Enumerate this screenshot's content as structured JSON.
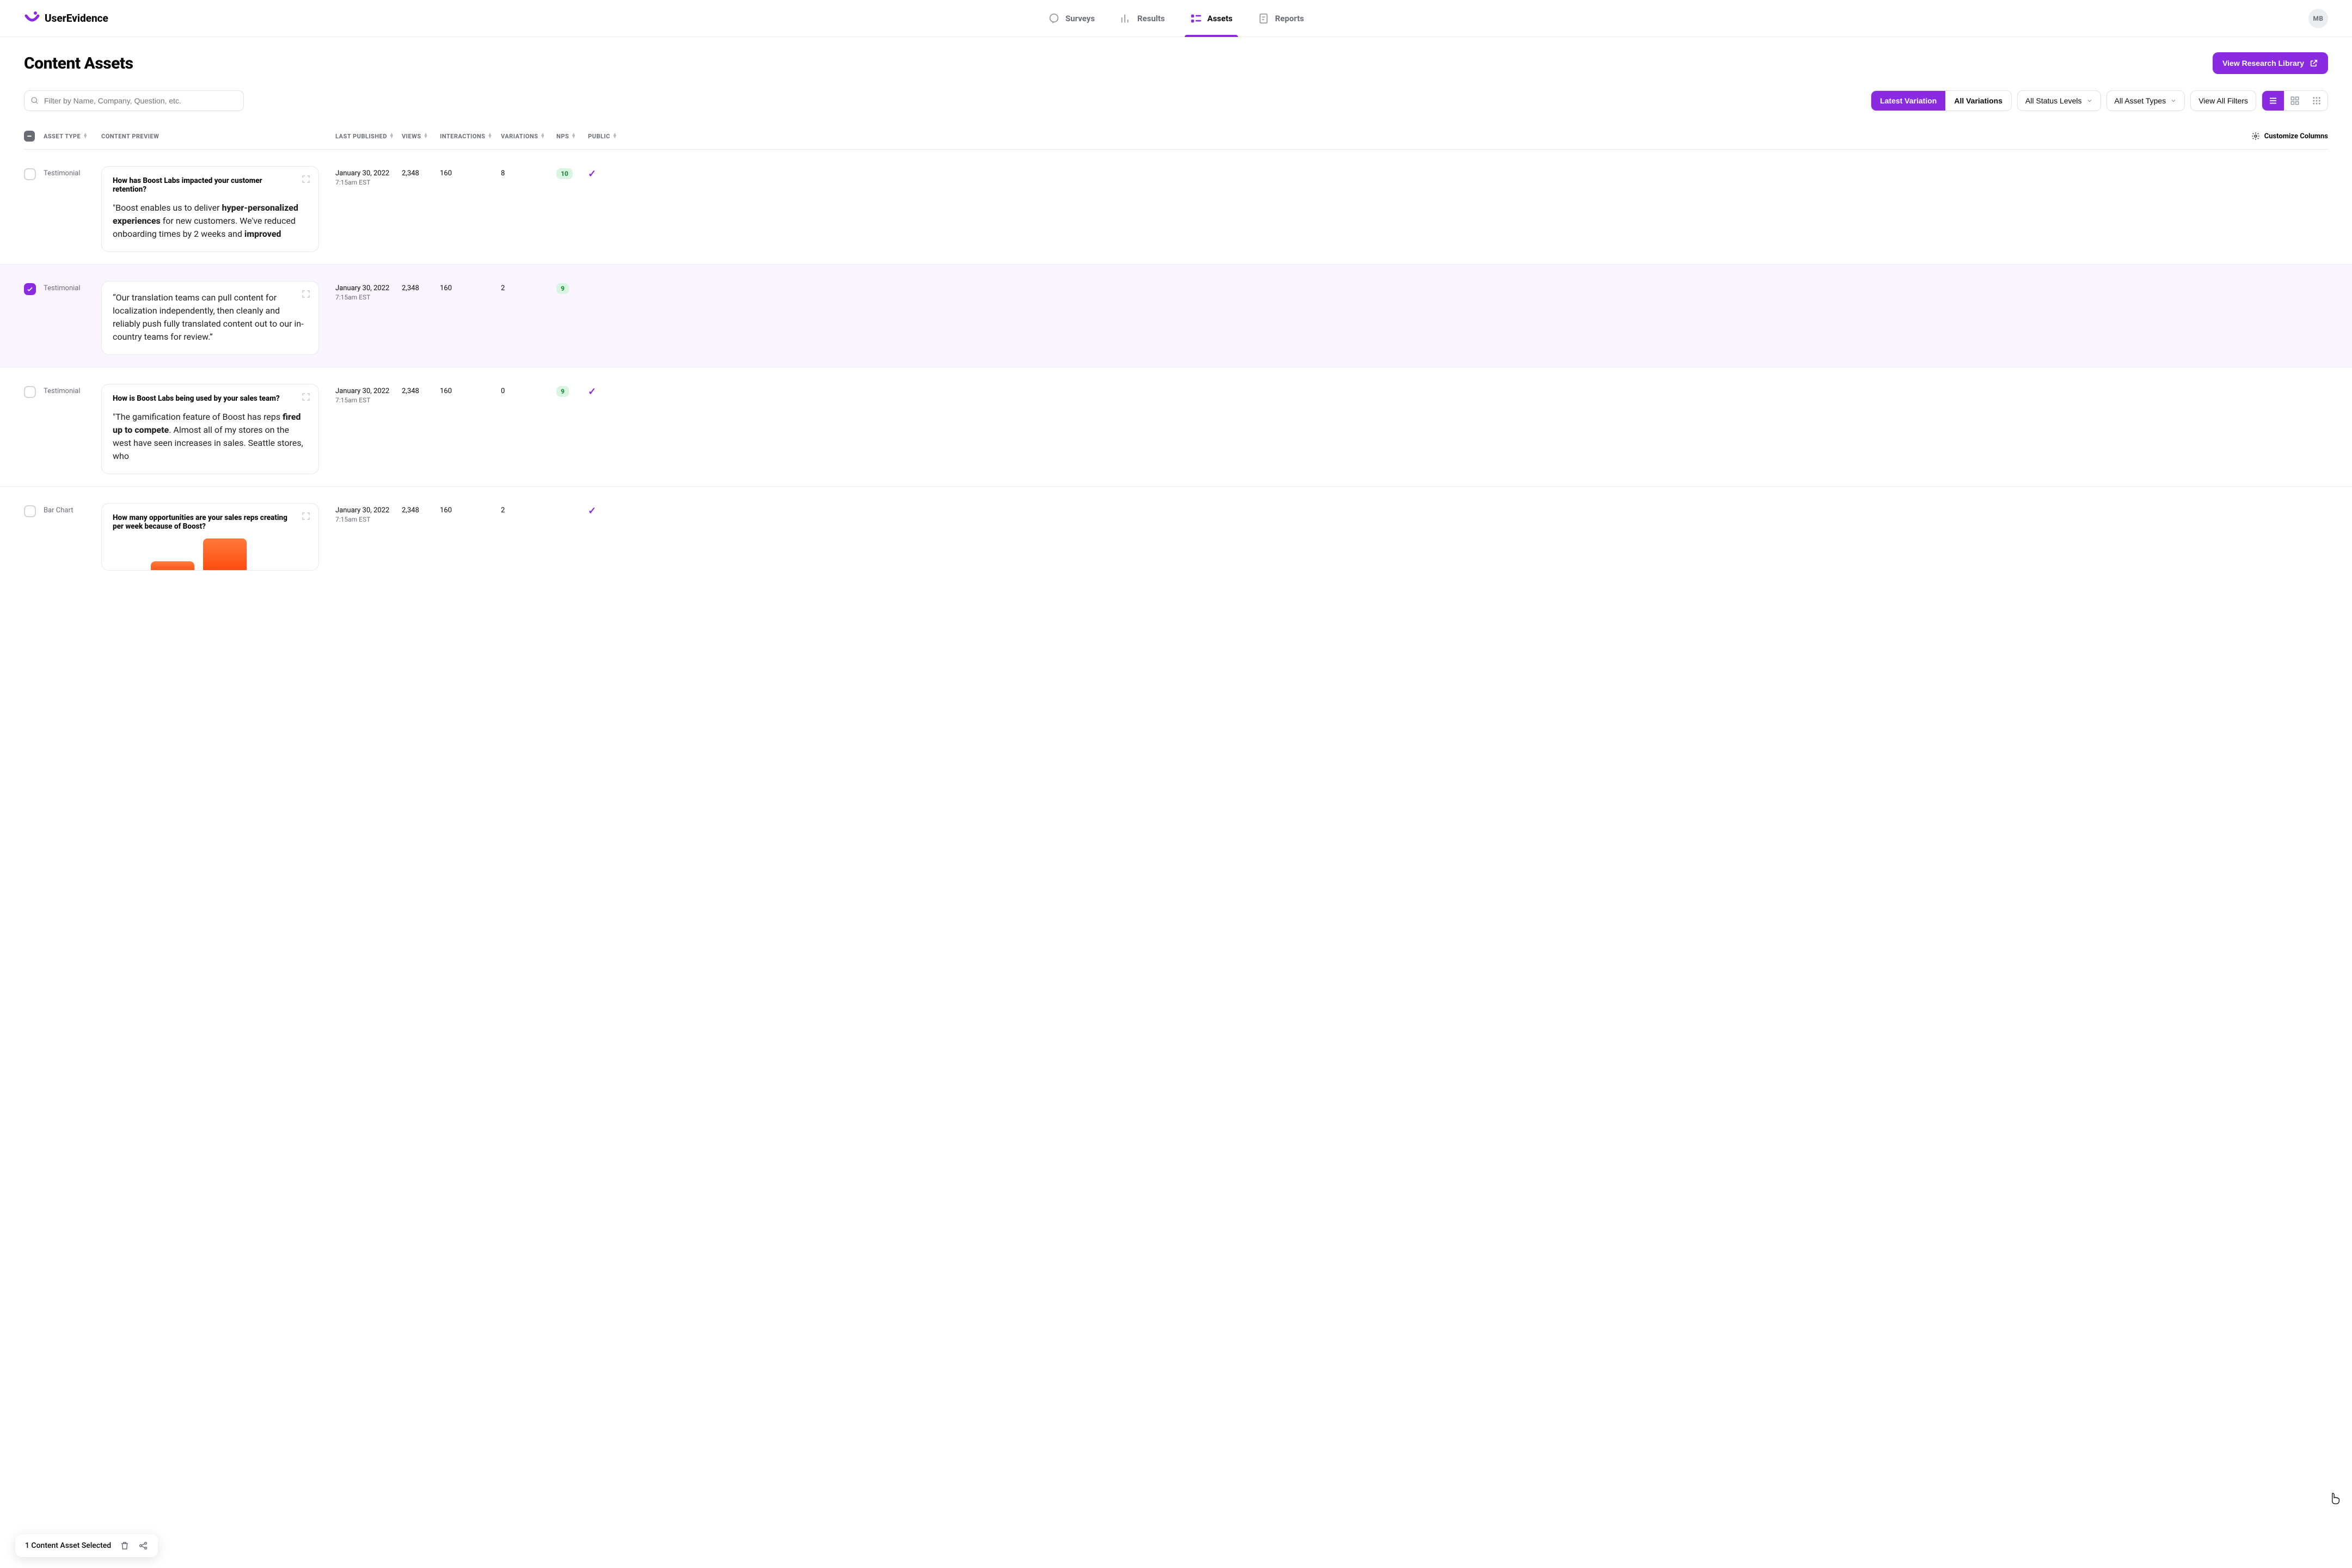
{
  "brand": "UserEvidence",
  "nav": {
    "surveys": "Surveys",
    "results": "Results",
    "assets": "Assets",
    "reports": "Reports",
    "active": "assets"
  },
  "avatar_initials": "MB",
  "page_title": "Content Assets",
  "research_btn": "View Research Library",
  "search_placeholder": "Filter by Name, Company, Question, etc.",
  "seg": {
    "latest": "Latest Variation",
    "all": "All Variations"
  },
  "filters": {
    "status": "All Status Levels",
    "types": "All Asset Types",
    "viewall": "View All Filters"
  },
  "columns": {
    "asset_type": "ASSET TYPE",
    "content_preview": "CONTENT PREVIEW",
    "last_published": "LAST PUBLISHED",
    "views": "VIEWS",
    "interactions": "INTERACTIONS",
    "variations": "VARIATIONS",
    "nps": "NPS",
    "public": "PUBLIC",
    "customize": "Customize Columns"
  },
  "rows": [
    {
      "selected": false,
      "type": "Testimonial",
      "question": "How has Boost Labs impacted your customer retention?",
      "body_pre": "\"Boost enables us to deliver ",
      "body_hl1": "hyper-personalized experiences",
      "body_mid": " for new customers. We've reduced onboarding times by 2 weeks and ",
      "body_hl2": "improved",
      "published_date": "January 30, 2022",
      "published_time": "7:15am EST",
      "views": "2,348",
      "interactions": "160",
      "variations": "8",
      "nps": "10",
      "public": true
    },
    {
      "selected": true,
      "type": "Testimonial",
      "question": "",
      "body": "“Our translation teams can pull content for localization independently, then cleanly and reliably push fully translated content out to our in-country teams for review.”",
      "published_date": "January 30, 2022",
      "published_time": "7:15am EST",
      "views": "2,348",
      "interactions": "160",
      "variations": "2",
      "nps": "9",
      "public": false
    },
    {
      "selected": false,
      "type": "Testimonial",
      "question": "How is Boost Labs being used by your sales team?",
      "body_pre": "\"The gamification feature of Boost has reps ",
      "body_hl1": "fired up to compete",
      "body_mid": ".  Almost all of my stores on the west have seen increases in sales. Seattle stores, who",
      "body_hl2": "",
      "published_date": "January 30, 2022",
      "published_time": "7:15am EST",
      "views": "2,348",
      "interactions": "160",
      "variations": "0",
      "nps": "9",
      "public": true
    },
    {
      "selected": false,
      "type": "Bar Chart",
      "question": "How many opportunities are your sales reps creating per week because of Boost?",
      "published_date": "January 30, 2022",
      "published_time": "7:15am EST",
      "views": "2,348",
      "interactions": "160",
      "variations": "2",
      "nps": "",
      "public": true
    }
  ],
  "selection_bar": "1 Content Asset Selected"
}
